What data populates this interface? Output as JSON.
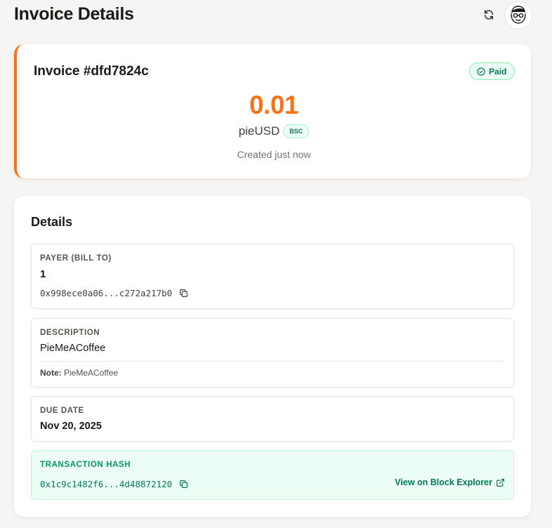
{
  "header": {
    "title": "Invoice Details",
    "refresh_icon": "refresh-icon",
    "avatar_icon": "avatar-illustration"
  },
  "invoice": {
    "id_label": "Invoice #dfd7824c",
    "status": "Paid",
    "amount": "0.01",
    "currency": "pieUSD",
    "chain": "BSC",
    "created": "Created just now"
  },
  "details": {
    "title": "Details",
    "payer": {
      "label": "PAYER (BILL TO)",
      "name": "1",
      "address": "0x998ece0a06...c272a217b0"
    },
    "description": {
      "label": "DESCRIPTION",
      "text": "PieMeACoffee",
      "note_label": "Note:",
      "note_text": "PieMeACoffee"
    },
    "due_date": {
      "label": "DUE DATE",
      "value": "Nov 20, 2025"
    },
    "transaction": {
      "label": "TRANSACTION HASH",
      "hash": "0x1c9c1482f6...4d48872120",
      "explorer_link": "View on Block Explorer"
    }
  },
  "colors": {
    "accent": "#f97316",
    "success": "#047857",
    "success_bg": "#ecfdf5",
    "page_bg": "#f5f5f4"
  }
}
